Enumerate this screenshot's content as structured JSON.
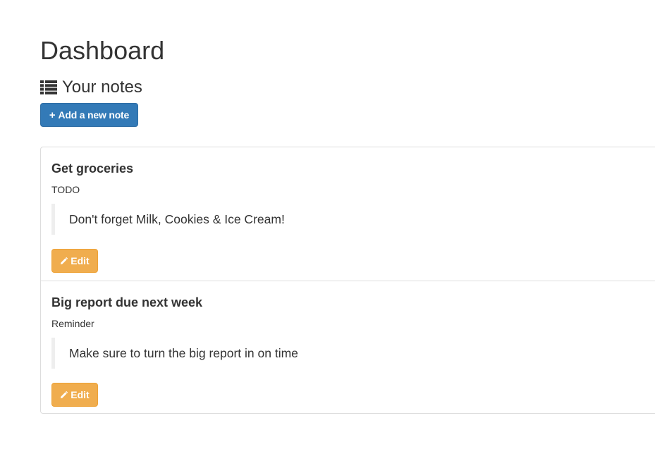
{
  "header": {
    "title": "Dashboard",
    "section_title": "Your notes",
    "section_icon": "list-icon"
  },
  "actions": {
    "add_note_label": "Add a new note",
    "add_note_icon": "plus-icon"
  },
  "notes": [
    {
      "title": "Get groceries",
      "tag": "TODO",
      "body": "Don't forget Milk, Cookies & Ice Cream!",
      "edit_label": "Edit",
      "edit_icon": "pencil-icon"
    },
    {
      "title": "Big report due next week",
      "tag": "Reminder",
      "body": "Make sure to turn the big report in on time",
      "edit_label": "Edit",
      "edit_icon": "pencil-icon"
    }
  ],
  "colors": {
    "primary": "#337ab7",
    "warning": "#f0ad4e",
    "text": "#333333",
    "border": "#dddddd",
    "blockquote_border": "#eeeeee"
  }
}
